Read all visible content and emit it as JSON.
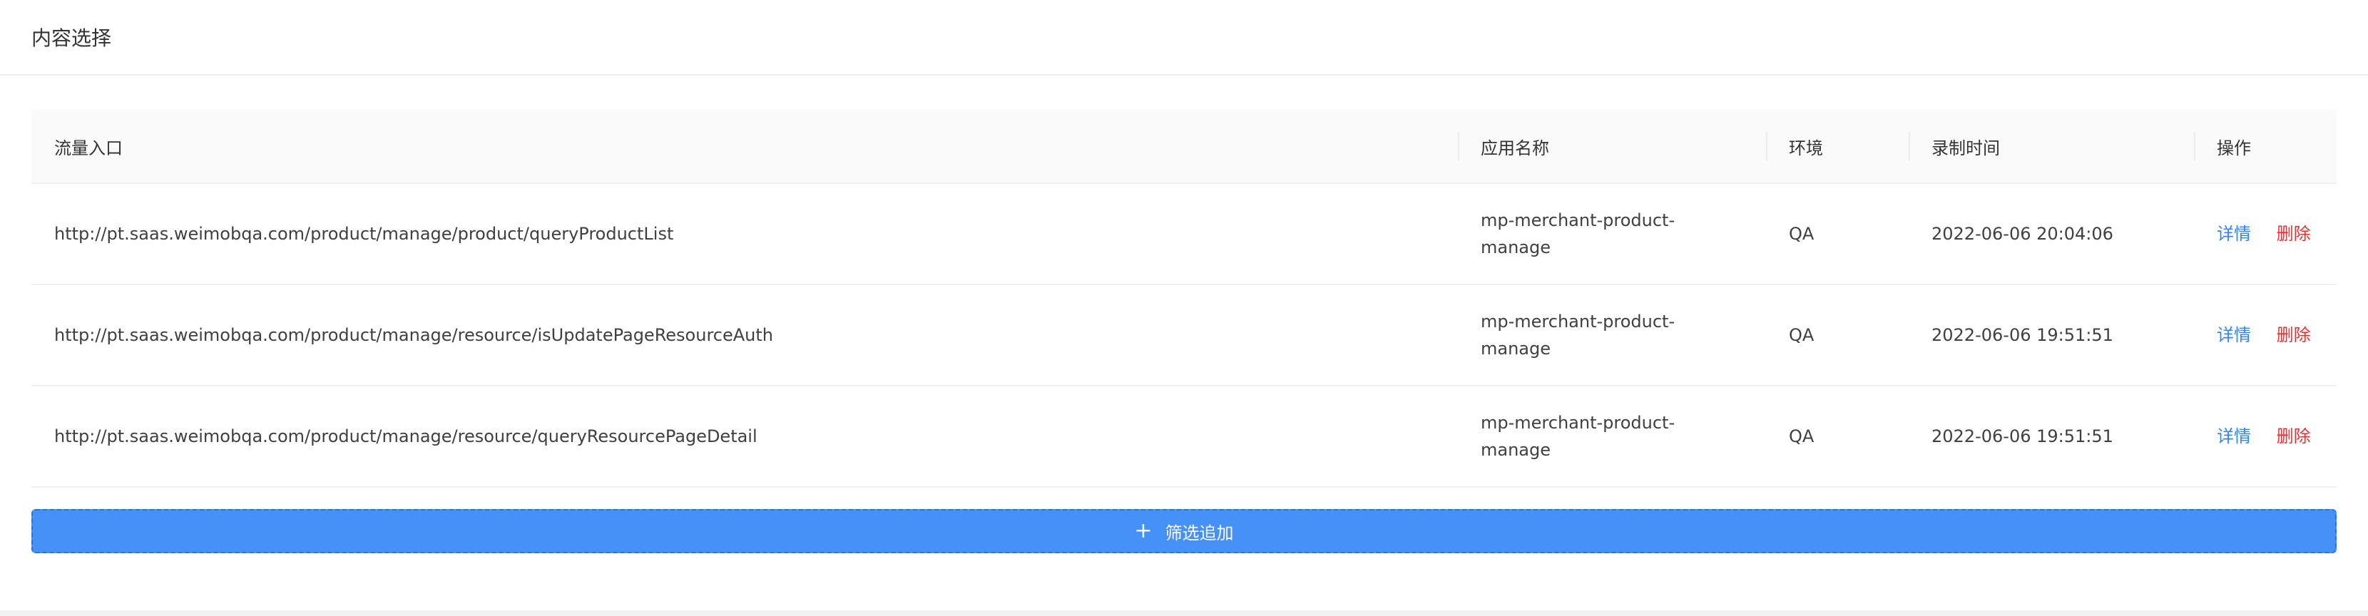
{
  "card": {
    "title": "内容选择"
  },
  "table": {
    "headers": {
      "entry": "流量入口",
      "app": "应用名称",
      "env": "环境",
      "time": "录制时间",
      "action": "操作"
    },
    "rows": [
      {
        "entry": "http://pt.saas.weimobqa.com/product/manage/product/queryProductList",
        "app": "mp-merchant-product-manage",
        "env": "QA",
        "time": "2022-06-06 20:04:06",
        "detail": "详情",
        "delete": "删除"
      },
      {
        "entry": "http://pt.saas.weimobqa.com/product/manage/resource/isUpdatePageResourceAuth",
        "app": "mp-merchant-product-manage",
        "env": "QA",
        "time": "2022-06-06 19:51:51",
        "detail": "详情",
        "delete": "删除"
      },
      {
        "entry": "http://pt.saas.weimobqa.com/product/manage/resource/queryResourcePageDetail",
        "app": "mp-merchant-product-manage",
        "env": "QA",
        "time": "2022-06-06 19:51:51",
        "detail": "详情",
        "delete": "删除"
      }
    ]
  },
  "add_button": {
    "icon": "plus-icon",
    "label": "筛选追加"
  },
  "colors": {
    "primary": "#4591f7",
    "link": "#2f86f6",
    "danger": "#f0302e",
    "header_bg": "#fafafa"
  }
}
